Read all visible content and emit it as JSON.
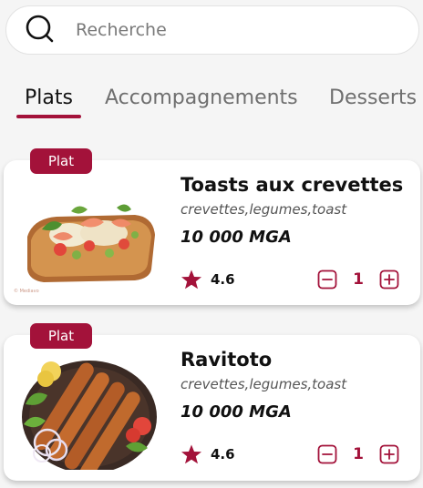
{
  "search": {
    "placeholder": "Recherche"
  },
  "tabs": [
    {
      "label": "Plats",
      "active": true
    },
    {
      "label": "Accompagnements",
      "active": false
    },
    {
      "label": "Desserts",
      "active": false
    }
  ],
  "colors": {
    "accent": "#a3123a",
    "star": "#a3123a"
  },
  "products": [
    {
      "badge": "Plat",
      "name": "Toasts aux crevettes",
      "ingredients": "crevettes,legumes,toast",
      "price": "10 000 MGA",
      "rating": "4.6",
      "quantity": "1",
      "image_credit": "© Mediavo",
      "image": "shrimp-toast-photo"
    },
    {
      "badge": "Plat",
      "name": "Ravitoto",
      "ingredients": "crevettes,legumes,toast",
      "price": "10 000 MGA",
      "rating": "4.6",
      "quantity": "1",
      "image": "skewers-plate-photo"
    }
  ],
  "icons": {
    "search": "search-icon",
    "star": "star-icon",
    "minus": "minus-square-icon",
    "plus": "plus-square-icon"
  }
}
